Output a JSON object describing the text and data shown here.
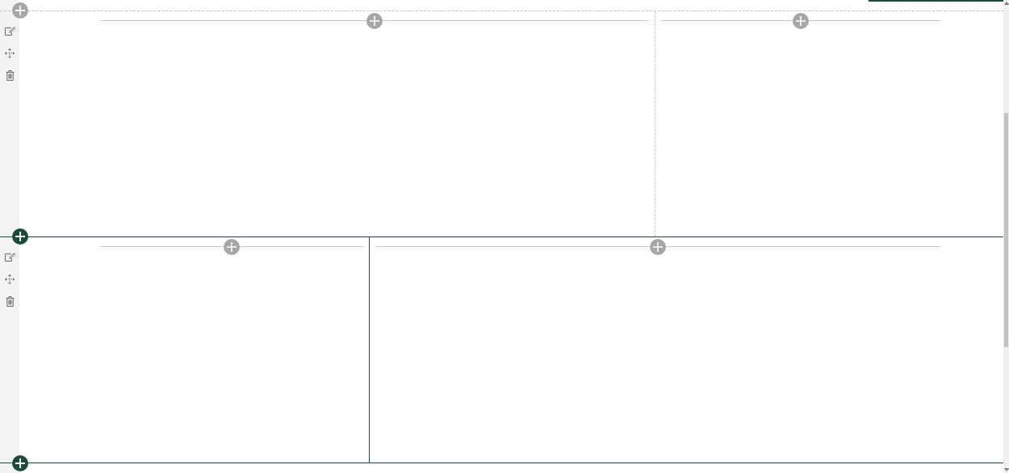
{
  "sections": [
    {
      "selected": false,
      "columns": [
        {
          "kind": "wide"
        },
        {
          "kind": "narrow"
        }
      ]
    },
    {
      "selected": true,
      "columns": [
        {
          "kind": "narrow"
        },
        {
          "kind": "wide"
        }
      ]
    }
  ]
}
